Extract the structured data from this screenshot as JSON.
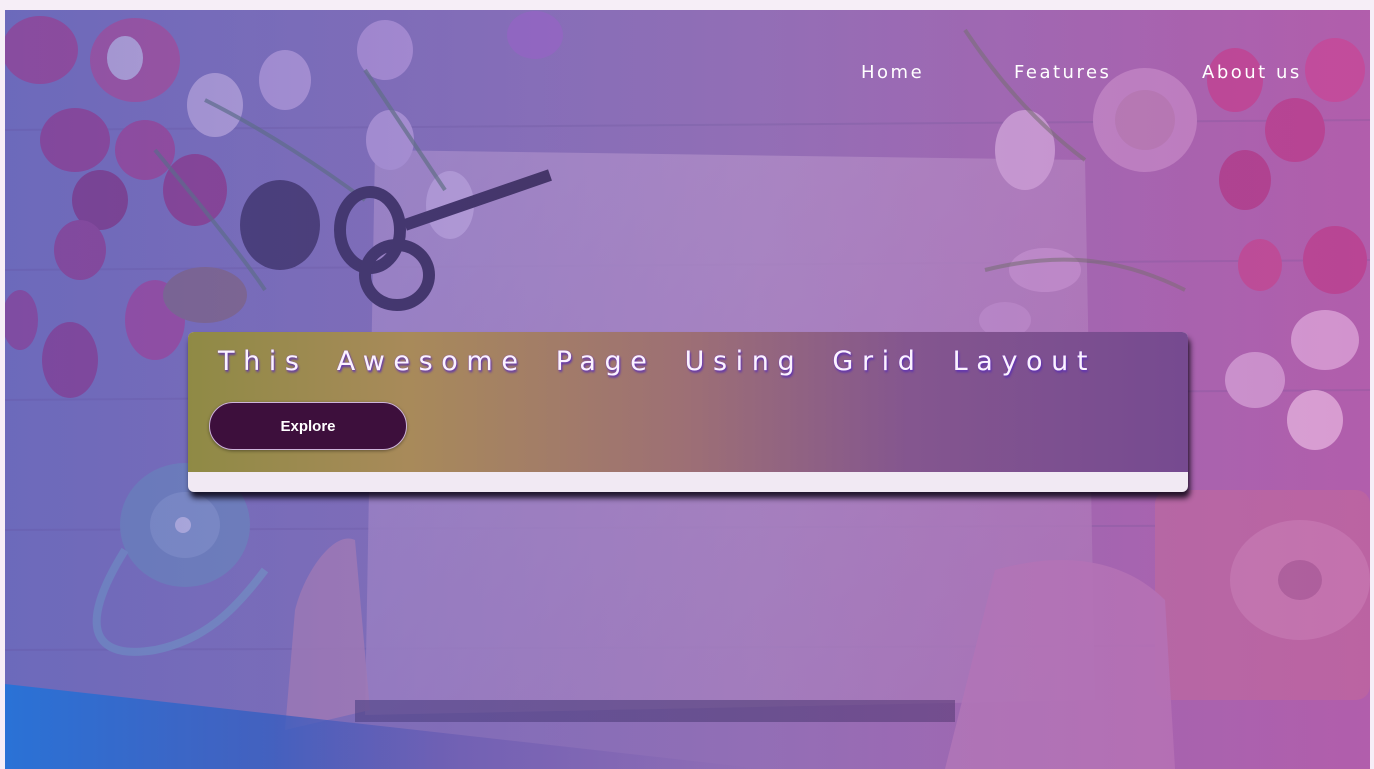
{
  "nav": {
    "items": [
      {
        "label": "Home"
      },
      {
        "label": "Features"
      },
      {
        "label": "About us"
      }
    ]
  },
  "hero": {
    "title": "This Awesome Page Using Grid Layout",
    "button_label": "Explore"
  },
  "colors": {
    "overlay_accent": "#8d5aa0",
    "button_bg": "#3d0f3c",
    "bottom_band": "#2a72d6"
  }
}
